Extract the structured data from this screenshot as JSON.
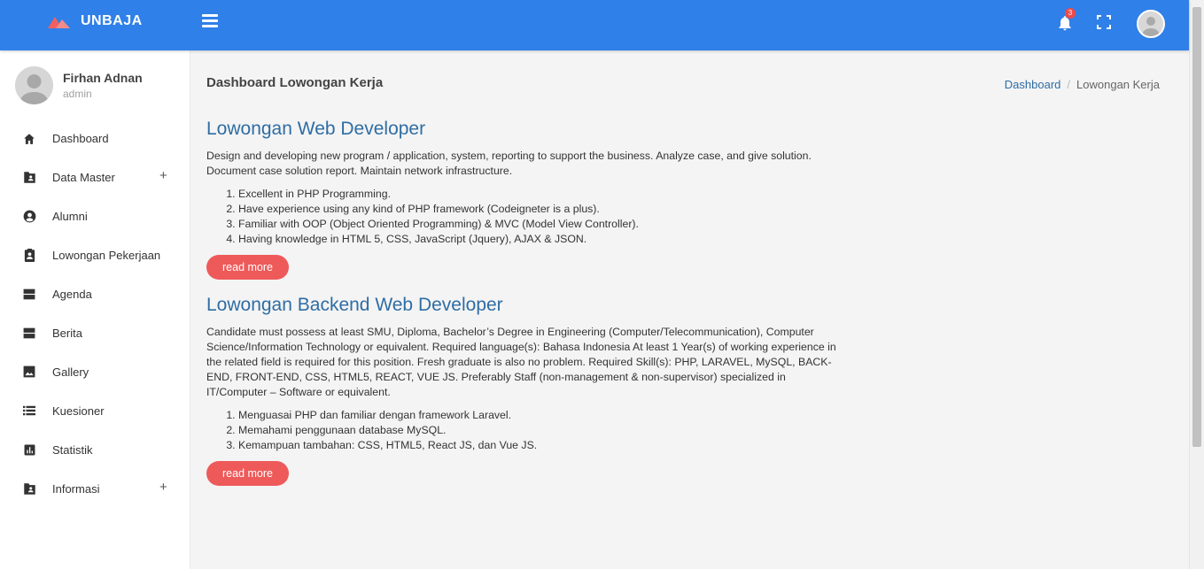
{
  "brand": {
    "name": "UNBAJA",
    "color": "#2f80e8"
  },
  "header": {
    "notification_count": "3",
    "icons": [
      "menu-icon",
      "bell-icon",
      "fullscreen-icon",
      "avatar"
    ]
  },
  "sidebar": {
    "user": {
      "name": "Firhan Adnan",
      "role": "admin"
    },
    "items": [
      {
        "label": "Dashboard",
        "icon": "home-icon"
      },
      {
        "label": "Data Master",
        "icon": "folder-user-icon",
        "expandable": "+"
      },
      {
        "label": "Alumni",
        "icon": "account-circle-icon"
      },
      {
        "label": "Lowongan Pekerjaan",
        "icon": "clipboard-user-icon"
      },
      {
        "label": "Agenda",
        "icon": "storage-icon"
      },
      {
        "label": "Berita",
        "icon": "storage-icon"
      },
      {
        "label": "Gallery",
        "icon": "image-icon"
      },
      {
        "label": "Kuesioner",
        "icon": "list-icon"
      },
      {
        "label": "Statistik",
        "icon": "chart-icon"
      },
      {
        "label": "Informasi",
        "icon": "folder-user-icon",
        "expandable": "+"
      }
    ]
  },
  "main": {
    "page_title": "Dashboard Lowongan Kerja",
    "breadcrumb": {
      "home": "Dashboard",
      "separator": "/",
      "current": "Lowongan Kerja"
    },
    "jobs": [
      {
        "title": "Lowongan Web Developer",
        "description": "Design and developing new program / application, system, reporting to support the business. Analyze case, and give solution. Document case solution report. Maintain network infrastructure.",
        "requirements": [
          "Excellent in PHP Programming.",
          "Have experience using any kind of PHP framework (Codeigneter is a plus).",
          "Familiar with OOP (Object Oriented Programming) & MVC (Model View Controller).",
          "Having knowledge in HTML 5, CSS, JavaScript (Jquery), AJAX & JSON."
        ],
        "button": "read more"
      },
      {
        "title": "Lowongan Backend Web Developer",
        "description": "Candidate must possess at least SMU, Diploma, Bachelor’s Degree in Engineering (Computer/Telecommunication), Computer Science/Information Technology or equivalent. Required language(s): Bahasa Indonesia At least 1 Year(s) of working experience in the related field is required for this position. Fresh graduate is also no problem. Required Skill(s): PHP, LARAVEL, MySQL, BACK-END, FRONT-END, CSS, HTML5, REACT, VUE JS. Preferably Staff (non-management & non-supervisor) specialized in IT/Computer – Software or equivalent.",
        "requirements": [
          "Menguasai PHP dan familiar dengan framework Laravel.",
          "Memahami penggunaan database MySQL.",
          "Kemampuan tambahan: CSS, HTML5, React JS, dan Vue JS."
        ],
        "button": "read more"
      }
    ]
  },
  "colors": {
    "accent": "#2f80e8",
    "button": "#ee5a5a",
    "link": "#2e6da4",
    "badge": "#ef4a4a"
  }
}
